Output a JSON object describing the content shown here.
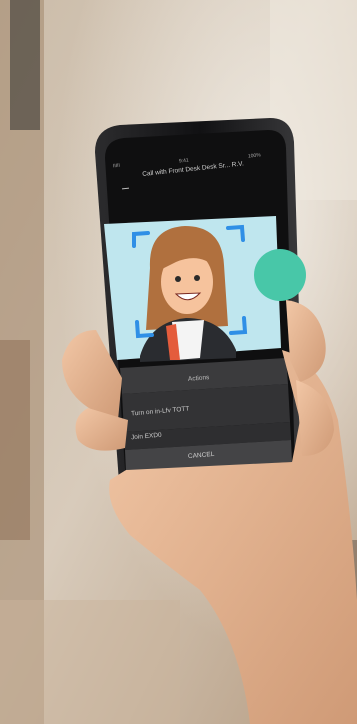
{
  "status_bar": {
    "left": "IIIII",
    "center": "9:41",
    "right": "100%"
  },
  "call": {
    "title": "Call with Front Desk Desk Sr... R.V."
  },
  "sheet": {
    "title": "Actions",
    "items": [
      "Turn on in-Lfv TOTT",
      "Join EXD0"
    ],
    "cancel": "CANCEL"
  },
  "colors": {
    "avatar_background": "#bfe6ee",
    "scan_frame": "#2f8fe6",
    "hair": "#b0703e",
    "accent_green": "#48c7a8"
  }
}
